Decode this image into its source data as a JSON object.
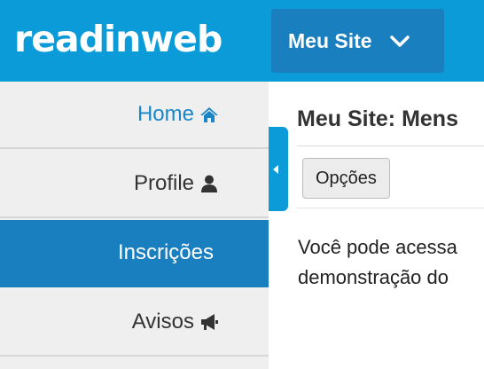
{
  "header": {
    "logo_text": "readinweb",
    "site_selector": {
      "label": "Meu Site",
      "icon": "chevron-down-icon"
    }
  },
  "sidebar": {
    "items": [
      {
        "label": "Home",
        "icon": "home-icon",
        "state": "default",
        "color": "#1a86c8"
      },
      {
        "label": "Profile",
        "icon": "user-icon",
        "state": "default"
      },
      {
        "label": "Inscrições",
        "icon": "",
        "state": "active"
      },
      {
        "label": "Avisos",
        "icon": "megaphone-icon",
        "state": "default"
      }
    ]
  },
  "main": {
    "title": "Meu Site: Mens",
    "options_button": "Opções",
    "paragraph_lines": [
      "Você pode acessa",
      "demonstração do"
    ]
  },
  "colors": {
    "header_bg": "#0a9bd8",
    "active_bg": "#1a7fbf",
    "sidebar_bg": "#efefef"
  }
}
